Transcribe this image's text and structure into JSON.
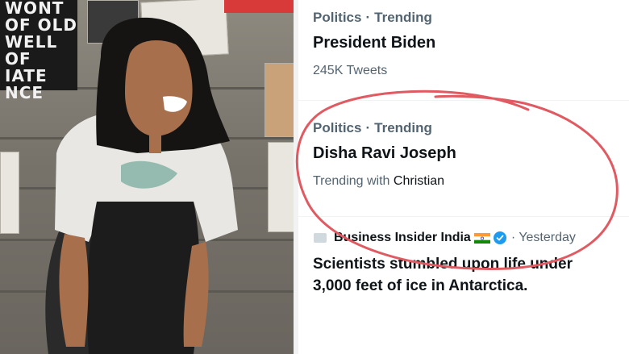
{
  "photo": {
    "sign_lines": [
      "WONT",
      "OF OLD",
      "WELL",
      "OF",
      "IATE",
      "NCE"
    ]
  },
  "trends": [
    {
      "category": "Politics",
      "status": "Trending",
      "title": "President Biden",
      "sub_prefix": "245K Tweets",
      "sub_highlight": ""
    },
    {
      "category": "Politics",
      "status": "Trending",
      "title": "Disha Ravi Joseph",
      "sub_prefix": "Trending with ",
      "sub_highlight": "Christian"
    }
  ],
  "news": {
    "source": "Business Insider India",
    "time": "· Yesterday",
    "headline": "Scientists stumbled upon life under 3,000 feet of ice in Antarctica."
  },
  "colors": {
    "annotation_circle": "#e05a62",
    "muted_text": "#536471",
    "primary_text": "#0f1419",
    "verified": "#1d9bf0"
  },
  "icons": [
    "india-flag-icon",
    "verified-badge-icon",
    "news-source-icon"
  ]
}
